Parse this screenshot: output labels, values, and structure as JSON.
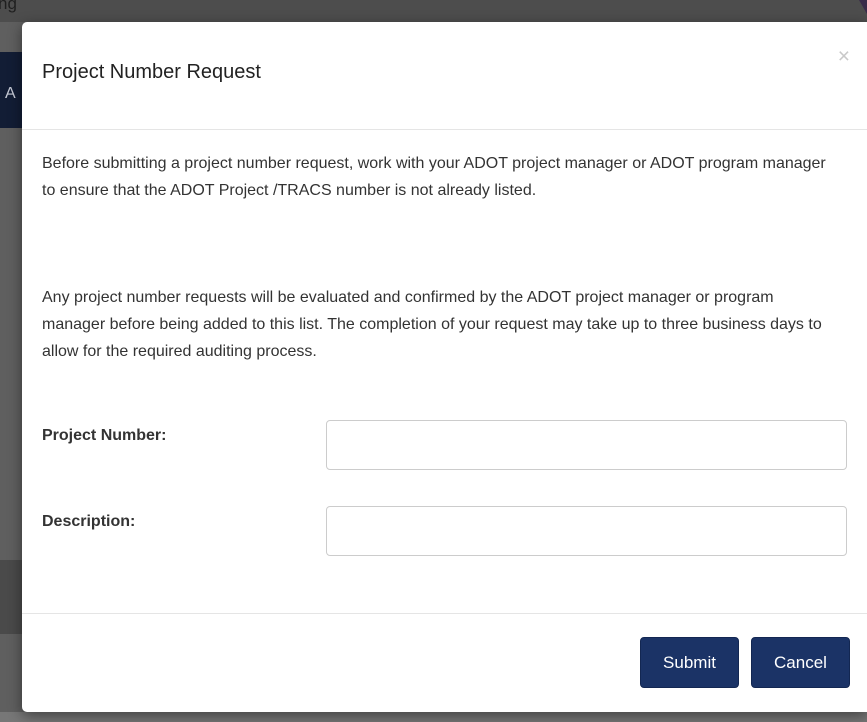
{
  "background": {
    "topbar_text": "ng",
    "nav_letter": "A"
  },
  "modal": {
    "title": "Project Number Request",
    "close_glyph": "×",
    "paragraph1": "Before submitting a project number request, work with your ADOT project manager or ADOT program manager to ensure that the ADOT Project /TRACS number is not already listed.",
    "paragraph2": "Any project number requests will be evaluated and confirmed by the ADOT project manager or program manager before being added to this list. The completion of your request may take up to three business days to allow for the required auditing process.",
    "form": {
      "project_number_label": "Project Number:",
      "project_number_value": "",
      "description_label": "Description:",
      "description_value": ""
    },
    "footer": {
      "submit_label": "Submit",
      "cancel_label": "Cancel"
    }
  },
  "colors": {
    "button_primary": "#1b3366",
    "overlay": "#5f5f5f",
    "nav_background": "#121d35"
  },
  "icons": {
    "close": "close-icon"
  }
}
